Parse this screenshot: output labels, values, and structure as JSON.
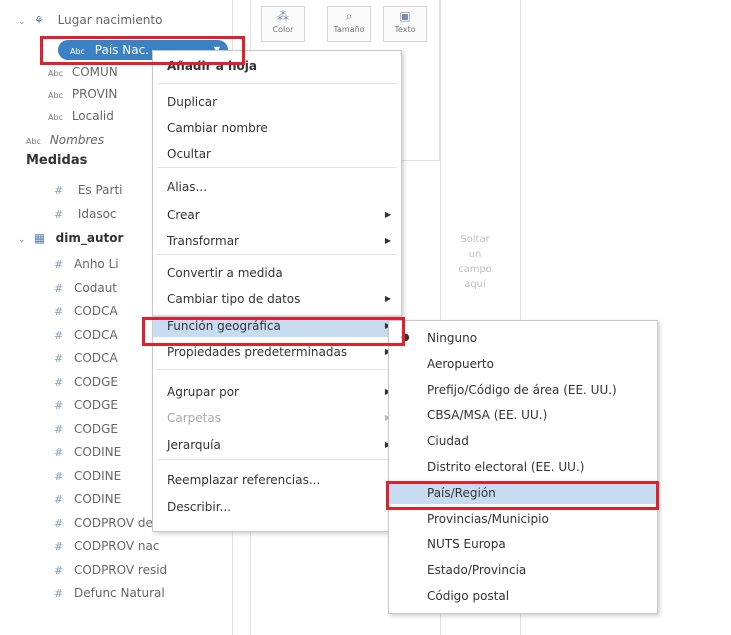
{
  "data_pane": {
    "dimension_rows": [
      {
        "label": "Lugar nacimiento",
        "type": "hierarchy"
      },
      {
        "label": "País Nac.",
        "type": "abc",
        "selected": true
      },
      {
        "label": "COMUN",
        "type": "abc"
      },
      {
        "label": "PROVIN",
        "type": "abc"
      },
      {
        "label": "Localid",
        "type": "abc"
      },
      {
        "label": "Nombres",
        "type": "abc"
      }
    ],
    "measures_title": "Medidas",
    "measure_rows": [
      {
        "label": "Es Parti"
      },
      {
        "label": "Idasoc"
      }
    ],
    "table_name": "dim_autor",
    "table_rows": [
      "Anho Li",
      "Codaut",
      "CODCA",
      "CODCA",
      "CODCA",
      "CODGE",
      "CODGE",
      "CODGE",
      "CODINE",
      "CODINE",
      "CODINE",
      "CODPROV defunc",
      "CODPROV nac",
      "CODPROV resid",
      "Defunc Natural"
    ]
  },
  "icons": {
    "abc": "Abc",
    "hash": "#",
    "chevron": "⌄",
    "submenu_arrow": "▶",
    "pill_dropdown": "▼"
  },
  "marks_card": {
    "buttons": [
      {
        "label": "Color",
        "icon": "⁂"
      },
      {
        "label": "Tamaño",
        "icon": "⌕"
      },
      {
        "label": "Texto",
        "icon": "▣"
      }
    ]
  },
  "drop_hint": "Soltar un campo aquí",
  "context_menu": {
    "items": [
      {
        "label": "Añadir a hoja",
        "bold": true
      },
      {
        "label": "Duplicar"
      },
      {
        "label": "Cambiar nombre"
      },
      {
        "label": "Ocultar"
      },
      {
        "label": "Alias..."
      },
      {
        "label": "Crear",
        "submenu": true
      },
      {
        "label": "Transformar",
        "submenu": true
      },
      {
        "label": "Convertir a medida"
      },
      {
        "label": "Cambiar tipo de datos",
        "submenu": true
      },
      {
        "label": "Función geográfica",
        "submenu": true,
        "highlighted": true
      },
      {
        "label": "Propiedades predeterminadas",
        "submenu": true
      },
      {
        "label": "Agrupar por",
        "submenu": true
      },
      {
        "label": "Carpetas",
        "submenu": true,
        "disabled": true
      },
      {
        "label": "Jerarquía",
        "submenu": true
      },
      {
        "label": "Reemplazar referencias..."
      },
      {
        "label": "Describir..."
      }
    ]
  },
  "geo_submenu": {
    "items": [
      {
        "label": "Ninguno",
        "checked": true
      },
      {
        "label": "Aeropuerto"
      },
      {
        "label": "Prefijo/Código de área (EE. UU.)"
      },
      {
        "label": "CBSA/MSA (EE. UU.)"
      },
      {
        "label": "Ciudad"
      },
      {
        "label": "Distrito electoral (EE. UU.)"
      },
      {
        "label": "País/Región",
        "highlighted": true
      },
      {
        "label": "Provincias/Municipio"
      },
      {
        "label": "NUTS Europa"
      },
      {
        "label": "Estado/Provincia"
      },
      {
        "label": "Código postal"
      }
    ]
  },
  "colors": {
    "highlight_red": "#e0202c",
    "pill_blue": "#3b82c4",
    "menu_highlight": "#c7dcf0"
  }
}
